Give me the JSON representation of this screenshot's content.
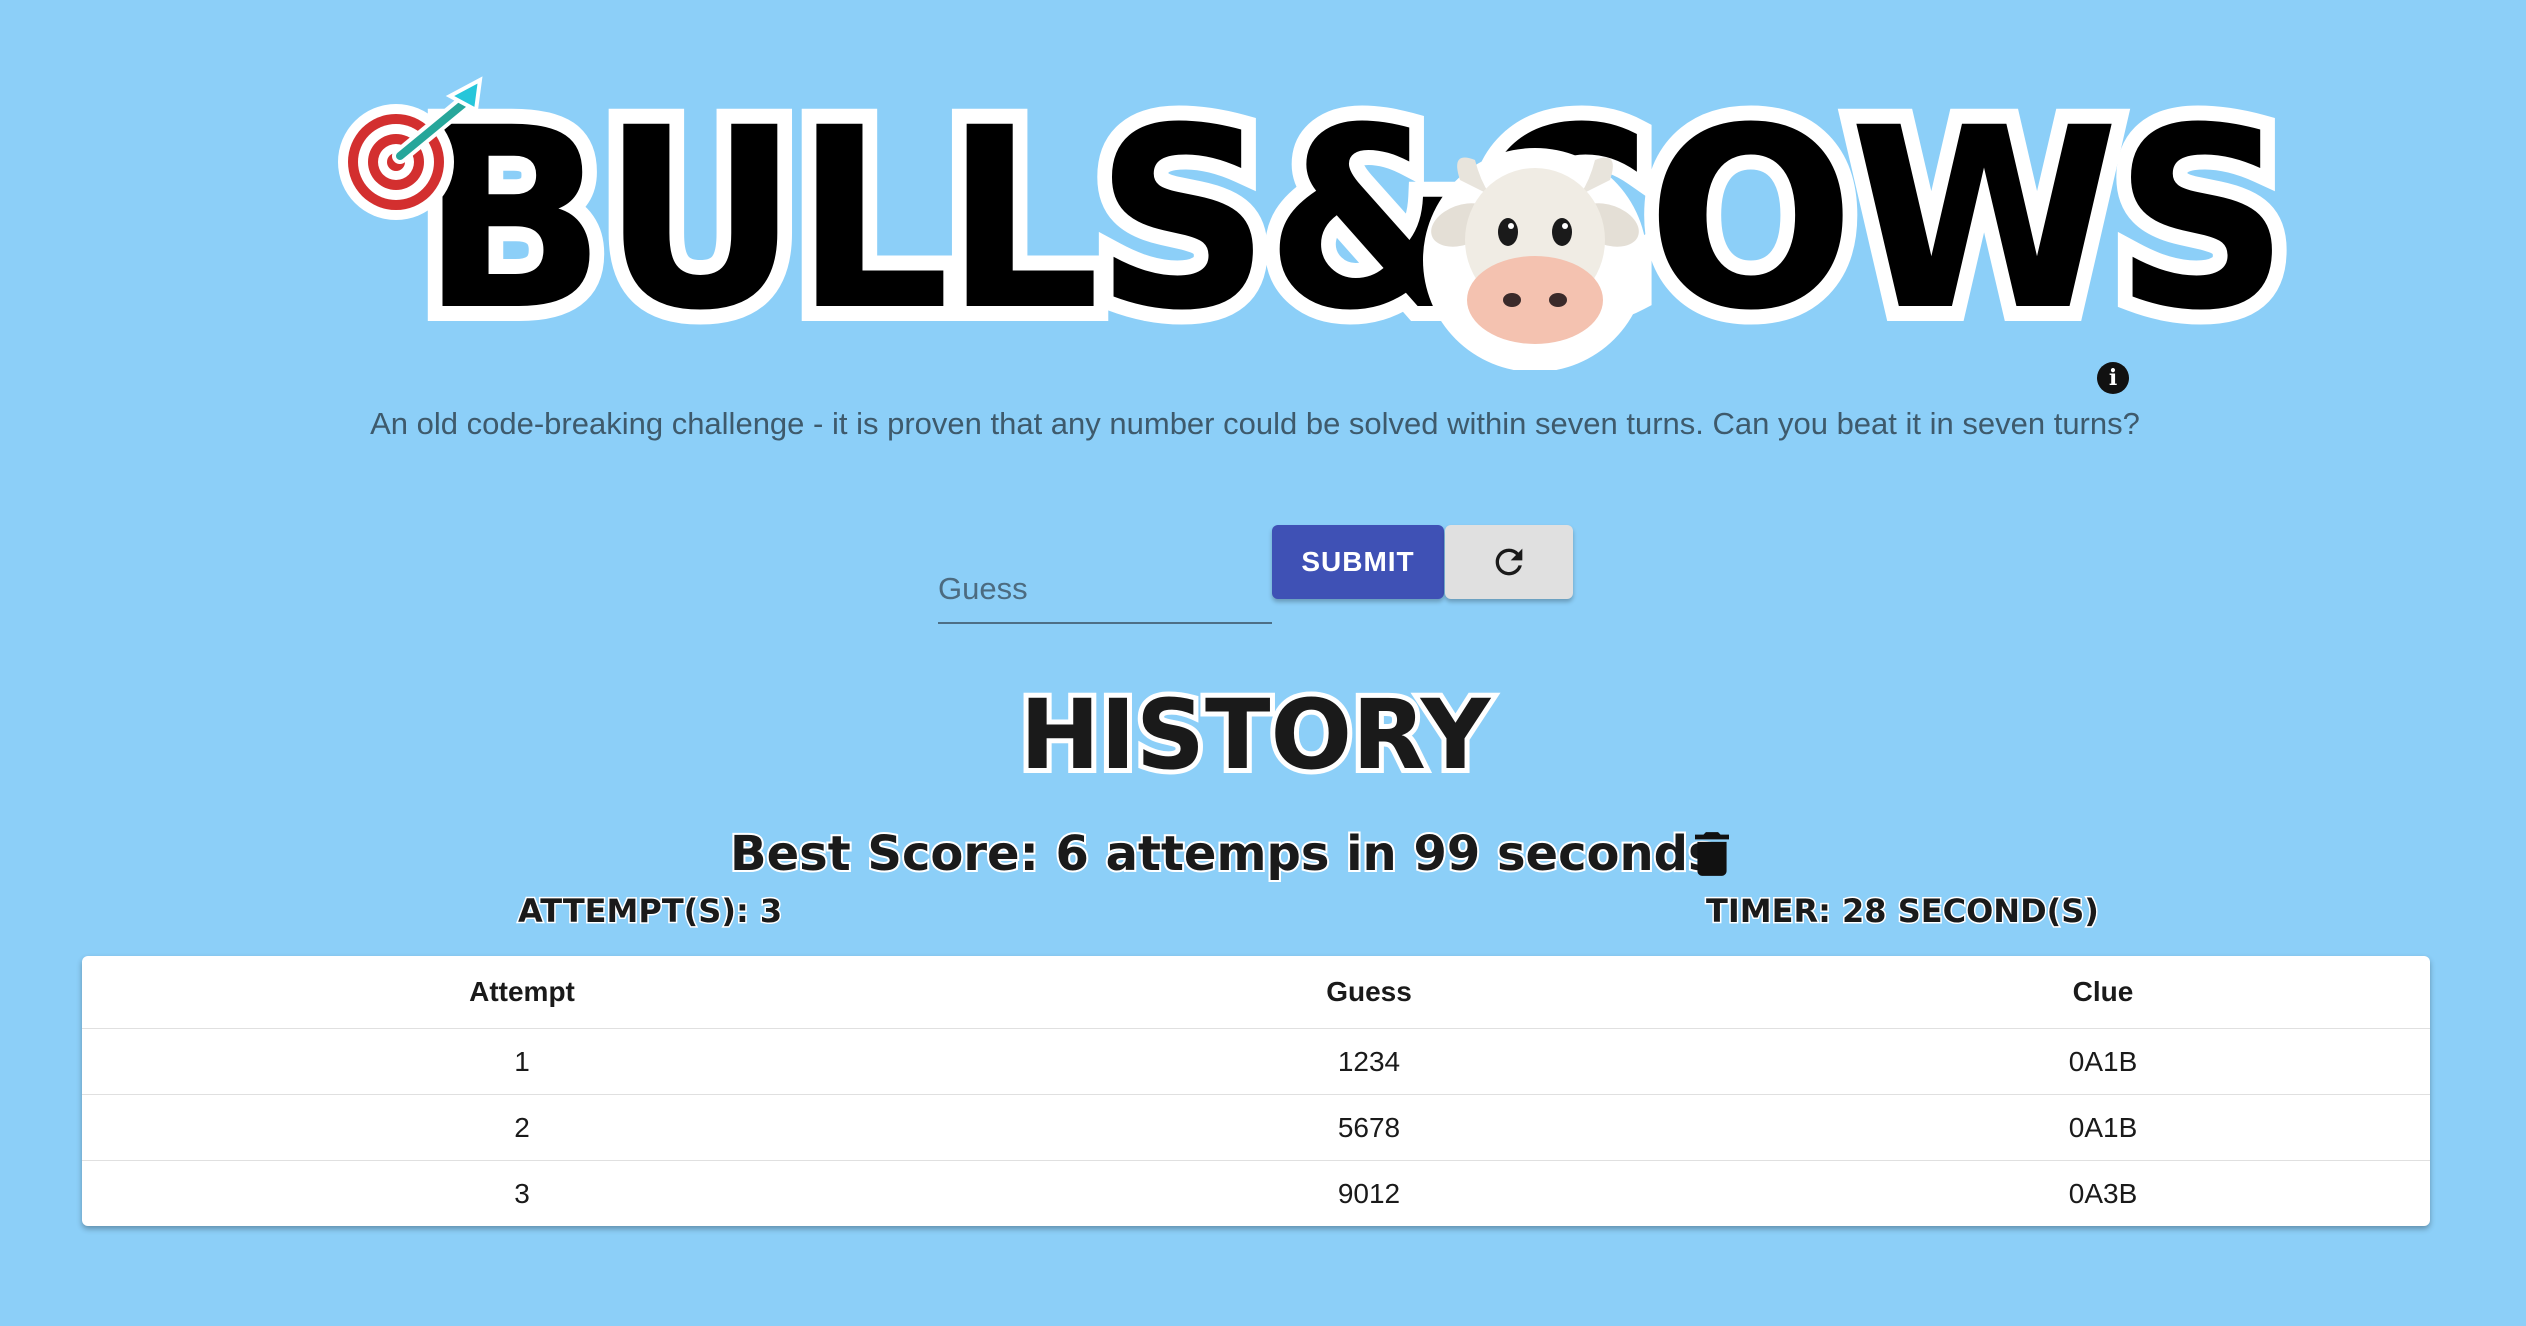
{
  "header": {
    "logo_text": "BULLS&COWS",
    "subtitle": "An old code-breaking challenge - it is proven that any number could be solved within seven turns. Can you beat it in seven turns?",
    "info_icon": "info-icon"
  },
  "form": {
    "guess_placeholder": "Guess",
    "guess_value": "",
    "submit_label": "SUBMIT",
    "reset_icon": "refresh-icon"
  },
  "history": {
    "title": "HISTORY",
    "best_score": "Best Score: 6 attemps in 99 seconds",
    "attempts_label": "ATTEMPT(S): 3",
    "timer_label": "TIMER: 28 SECOND(S)",
    "clear_icon": "trash-icon",
    "columns": [
      "Attempt",
      "Guess",
      "Clue"
    ],
    "rows": [
      {
        "attempt": "1",
        "guess": "1234",
        "clue": "0A1B"
      },
      {
        "attempt": "2",
        "guess": "5678",
        "clue": "0A1B"
      },
      {
        "attempt": "3",
        "guess": "9012",
        "clue": "0A3B"
      }
    ]
  },
  "colors": {
    "background": "#8ccff8",
    "primary": "#3f51b5",
    "reset_button": "#e0e0e0"
  }
}
